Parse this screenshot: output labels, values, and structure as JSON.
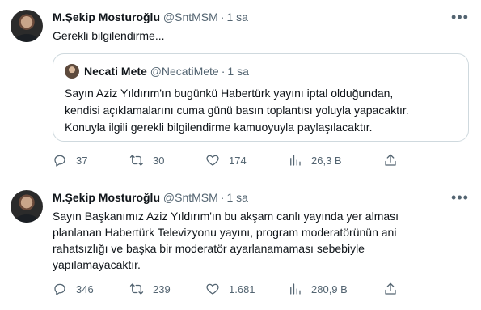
{
  "tweets": [
    {
      "author": {
        "name": "M.Şekip Mosturoğlu",
        "handle": "@SntMSM"
      },
      "separator": "·",
      "time": "1 sa",
      "text": "Gerekli bilgilendirme...",
      "quote": {
        "author": {
          "name": "Necati Mete",
          "handle": "@NecatiMete"
        },
        "separator": "·",
        "time": "1 sa",
        "lines": [
          "Sayın Aziz Yıldırım'ın bugünkü Habertürk yayını iptal olduğundan,",
          "kendisi açıklamalarını cuma günü basın toplantısı yoluyla yapacaktır.",
          "Konuyla ilgili gerekli bilgilendirme kamuoyuyla paylaşılacaktır."
        ]
      },
      "stats": {
        "replies": "37",
        "retweets": "30",
        "likes": "174",
        "views": "26,3 B"
      }
    },
    {
      "author": {
        "name": "M.Şekip Mosturoğlu",
        "handle": "@SntMSM"
      },
      "separator": "·",
      "time": "1 sa",
      "lines": [
        "Sayın Başkanımız Aziz Yıldırım'ın bu akşam canlı yayında yer alması",
        "planlanan Habertürk Televizyonu yayını, program moderatörünün ani",
        "rahatsızlığı ve başka bir moderatör ayarlanamaması sebebiyle",
        "yapılamayacaktır."
      ],
      "stats": {
        "replies": "346",
        "retweets": "239",
        "likes": "1.681",
        "views": "280,9 B"
      }
    }
  ],
  "icons": {
    "more": "more-horizontal-icon",
    "reply": "reply-icon",
    "retweet": "retweet-icon",
    "like": "heart-icon",
    "views": "views-bar-chart-icon",
    "share": "share-icon"
  },
  "colors": {
    "text": "#0f1419",
    "secondary": "#536471",
    "border": "#cfd9de"
  }
}
